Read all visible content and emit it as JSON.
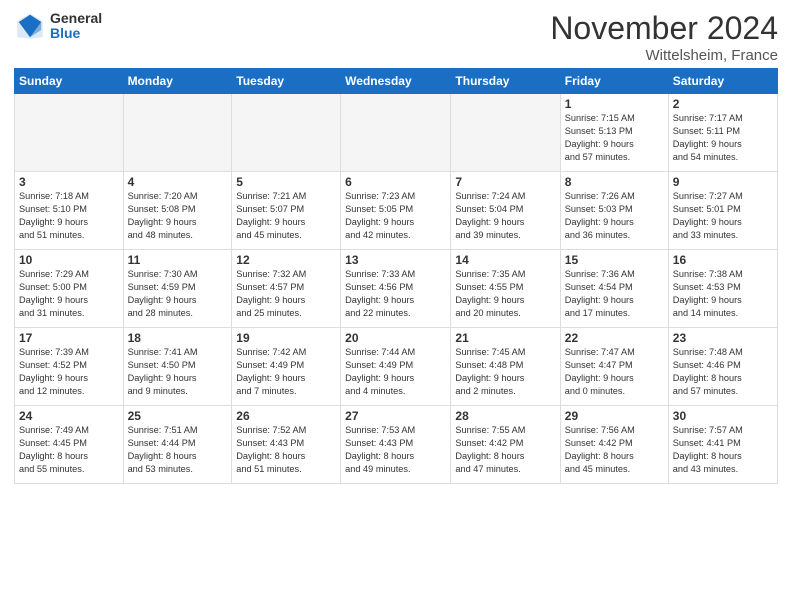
{
  "header": {
    "logo": {
      "general": "General",
      "blue": "Blue"
    },
    "title": "November 2024",
    "location": "Wittelsheim, France"
  },
  "weekdays": [
    "Sunday",
    "Monday",
    "Tuesday",
    "Wednesday",
    "Thursday",
    "Friday",
    "Saturday"
  ],
  "weeks": [
    [
      {
        "day": "",
        "info": "",
        "empty": true
      },
      {
        "day": "",
        "info": "",
        "empty": true
      },
      {
        "day": "",
        "info": "",
        "empty": true
      },
      {
        "day": "",
        "info": "",
        "empty": true
      },
      {
        "day": "",
        "info": "",
        "empty": true
      },
      {
        "day": "1",
        "info": "Sunrise: 7:15 AM\nSunset: 5:13 PM\nDaylight: 9 hours\nand 57 minutes."
      },
      {
        "day": "2",
        "info": "Sunrise: 7:17 AM\nSunset: 5:11 PM\nDaylight: 9 hours\nand 54 minutes."
      }
    ],
    [
      {
        "day": "3",
        "info": "Sunrise: 7:18 AM\nSunset: 5:10 PM\nDaylight: 9 hours\nand 51 minutes."
      },
      {
        "day": "4",
        "info": "Sunrise: 7:20 AM\nSunset: 5:08 PM\nDaylight: 9 hours\nand 48 minutes."
      },
      {
        "day": "5",
        "info": "Sunrise: 7:21 AM\nSunset: 5:07 PM\nDaylight: 9 hours\nand 45 minutes."
      },
      {
        "day": "6",
        "info": "Sunrise: 7:23 AM\nSunset: 5:05 PM\nDaylight: 9 hours\nand 42 minutes."
      },
      {
        "day": "7",
        "info": "Sunrise: 7:24 AM\nSunset: 5:04 PM\nDaylight: 9 hours\nand 39 minutes."
      },
      {
        "day": "8",
        "info": "Sunrise: 7:26 AM\nSunset: 5:03 PM\nDaylight: 9 hours\nand 36 minutes."
      },
      {
        "day": "9",
        "info": "Sunrise: 7:27 AM\nSunset: 5:01 PM\nDaylight: 9 hours\nand 33 minutes."
      }
    ],
    [
      {
        "day": "10",
        "info": "Sunrise: 7:29 AM\nSunset: 5:00 PM\nDaylight: 9 hours\nand 31 minutes."
      },
      {
        "day": "11",
        "info": "Sunrise: 7:30 AM\nSunset: 4:59 PM\nDaylight: 9 hours\nand 28 minutes."
      },
      {
        "day": "12",
        "info": "Sunrise: 7:32 AM\nSunset: 4:57 PM\nDaylight: 9 hours\nand 25 minutes."
      },
      {
        "day": "13",
        "info": "Sunrise: 7:33 AM\nSunset: 4:56 PM\nDaylight: 9 hours\nand 22 minutes."
      },
      {
        "day": "14",
        "info": "Sunrise: 7:35 AM\nSunset: 4:55 PM\nDaylight: 9 hours\nand 20 minutes."
      },
      {
        "day": "15",
        "info": "Sunrise: 7:36 AM\nSunset: 4:54 PM\nDaylight: 9 hours\nand 17 minutes."
      },
      {
        "day": "16",
        "info": "Sunrise: 7:38 AM\nSunset: 4:53 PM\nDaylight: 9 hours\nand 14 minutes."
      }
    ],
    [
      {
        "day": "17",
        "info": "Sunrise: 7:39 AM\nSunset: 4:52 PM\nDaylight: 9 hours\nand 12 minutes."
      },
      {
        "day": "18",
        "info": "Sunrise: 7:41 AM\nSunset: 4:50 PM\nDaylight: 9 hours\nand 9 minutes."
      },
      {
        "day": "19",
        "info": "Sunrise: 7:42 AM\nSunset: 4:49 PM\nDaylight: 9 hours\nand 7 minutes."
      },
      {
        "day": "20",
        "info": "Sunrise: 7:44 AM\nSunset: 4:49 PM\nDaylight: 9 hours\nand 4 minutes."
      },
      {
        "day": "21",
        "info": "Sunrise: 7:45 AM\nSunset: 4:48 PM\nDaylight: 9 hours\nand 2 minutes."
      },
      {
        "day": "22",
        "info": "Sunrise: 7:47 AM\nSunset: 4:47 PM\nDaylight: 9 hours\nand 0 minutes."
      },
      {
        "day": "23",
        "info": "Sunrise: 7:48 AM\nSunset: 4:46 PM\nDaylight: 8 hours\nand 57 minutes."
      }
    ],
    [
      {
        "day": "24",
        "info": "Sunrise: 7:49 AM\nSunset: 4:45 PM\nDaylight: 8 hours\nand 55 minutes."
      },
      {
        "day": "25",
        "info": "Sunrise: 7:51 AM\nSunset: 4:44 PM\nDaylight: 8 hours\nand 53 minutes."
      },
      {
        "day": "26",
        "info": "Sunrise: 7:52 AM\nSunset: 4:43 PM\nDaylight: 8 hours\nand 51 minutes."
      },
      {
        "day": "27",
        "info": "Sunrise: 7:53 AM\nSunset: 4:43 PM\nDaylight: 8 hours\nand 49 minutes."
      },
      {
        "day": "28",
        "info": "Sunrise: 7:55 AM\nSunset: 4:42 PM\nDaylight: 8 hours\nand 47 minutes."
      },
      {
        "day": "29",
        "info": "Sunrise: 7:56 AM\nSunset: 4:42 PM\nDaylight: 8 hours\nand 45 minutes."
      },
      {
        "day": "30",
        "info": "Sunrise: 7:57 AM\nSunset: 4:41 PM\nDaylight: 8 hours\nand 43 minutes."
      }
    ]
  ]
}
